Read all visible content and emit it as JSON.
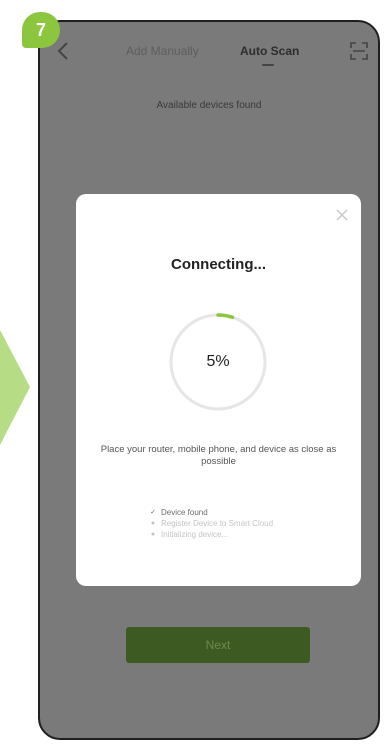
{
  "step_badge": "7",
  "colors": {
    "accent": "#8cc63f",
    "overlay": "#7a7a7a",
    "progress_track": "#e6e6e6",
    "progress_fill": "#8cc63f"
  },
  "header": {
    "tab_manual": "Add Manually",
    "tab_auto": "Auto Scan",
    "back_icon": "chevron-left-icon",
    "scan_icon": "scan-frame-icon"
  },
  "available_text": "Available devices found",
  "modal": {
    "title": "Connecting...",
    "progress": 5,
    "progress_label": "5%",
    "hint": "Place your router, mobile phone, and device as close as possible",
    "close_icon": "close-icon",
    "steps": [
      {
        "label": "Device found",
        "status": "done",
        "mark": "✓"
      },
      {
        "label": "Register Device to Smart Cloud",
        "status": "pending",
        "mark": "●"
      },
      {
        "label": "Initializing device...",
        "status": "pending",
        "mark": "●"
      }
    ]
  },
  "next_button": "Next"
}
